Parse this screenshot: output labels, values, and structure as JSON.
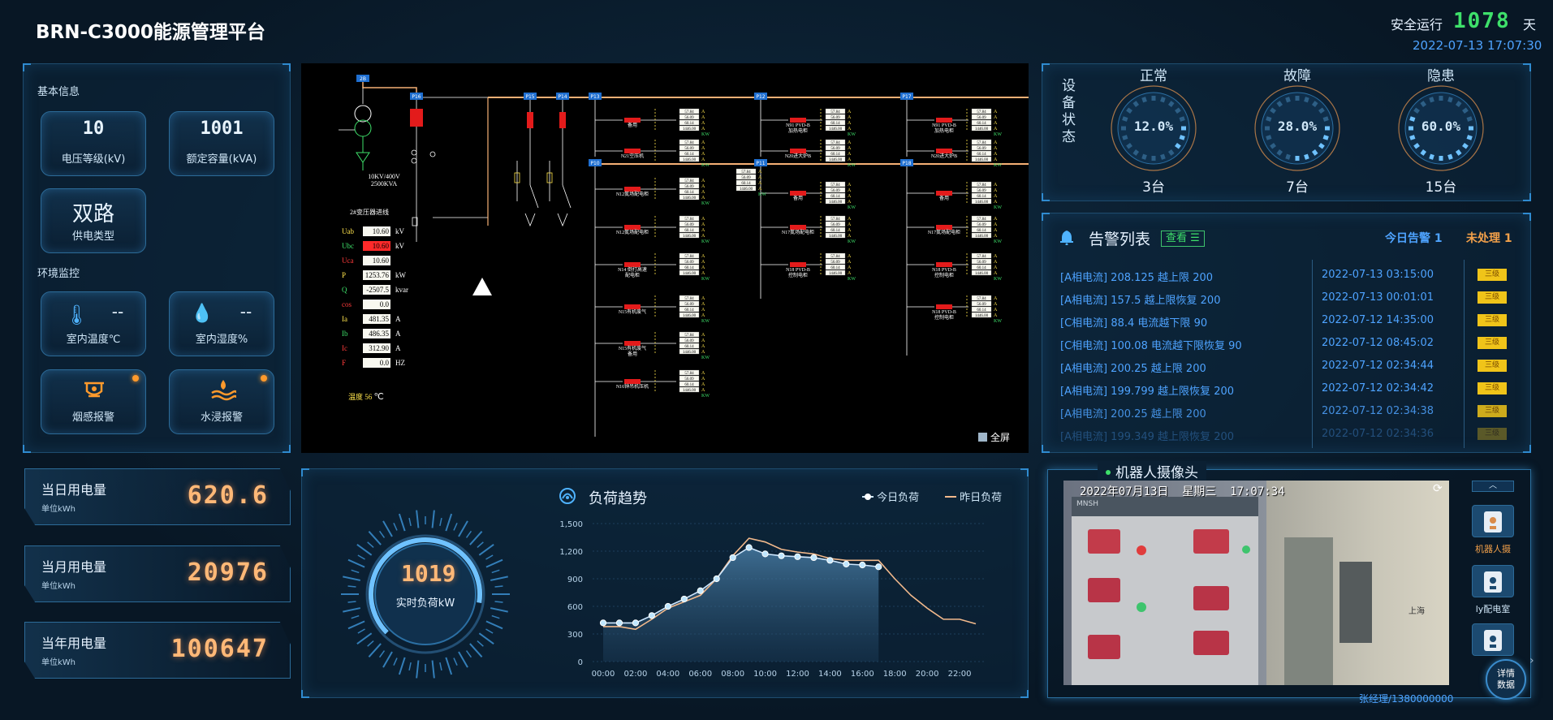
{
  "header": {
    "title": "BRN-C3000能源管理平台",
    "safe_run_label": "安全运行",
    "safe_run_days": "1078",
    "safe_run_unit": "天",
    "datetime": "2022-07-13 17:07:30"
  },
  "basic_info": {
    "title": "基本信息",
    "voltage": {
      "value": "10",
      "label": "电压等级(kV)"
    },
    "capacity": {
      "value": "1001",
      "label": "额定容量(kVA)"
    },
    "supply": {
      "value": "双路",
      "label": "供电类型"
    }
  },
  "env_monitor": {
    "title": "环境监控",
    "temp": {
      "value": "--",
      "label": "室内温度℃"
    },
    "humidity": {
      "value": "--",
      "label": "室内湿度%"
    },
    "smoke": {
      "label": "烟感报警"
    },
    "water": {
      "label": "水浸报警"
    }
  },
  "energy": {
    "day": {
      "title": "当日用电量",
      "unit": "单位kWh",
      "value": "620.6"
    },
    "month": {
      "title": "当月用电量",
      "unit": "单位kWh",
      "value": "20976"
    },
    "year": {
      "title": "当年用电量",
      "unit": "单位kWh",
      "value": "100647"
    }
  },
  "diagram": {
    "fullscreen": "全屏",
    "transformer_spec": "10KV/400V\n2500KVA",
    "transformer_label": "2#变压器进线",
    "temp_label": "温度",
    "temp_value": "56",
    "temp_unit": "℃",
    "meter_rows": [
      {
        "name": "Uab",
        "value": "10.60",
        "unit": "kV",
        "alarm": false
      },
      {
        "name": "Ubc",
        "value": "10.60",
        "unit": "kV",
        "alarm": true
      },
      {
        "name": "Uca",
        "value": "10.60",
        "unit": "",
        "alarm": false
      },
      {
        "name": "P",
        "value": "1253.76",
        "unit": "kW",
        "alarm": false
      },
      {
        "name": "Q",
        "value": "-2507.5",
        "unit": "kvar",
        "alarm": false
      },
      {
        "name": "cos",
        "value": "0.0",
        "unit": "",
        "alarm": false
      },
      {
        "name": "Ia",
        "value": "481.35",
        "unit": "A",
        "alarm": false
      },
      {
        "name": "Ib",
        "value": "486.35",
        "unit": "A",
        "alarm": false
      },
      {
        "name": "Ic",
        "value": "312.90",
        "unit": "A",
        "alarm": false
      },
      {
        "name": "F",
        "value": "0.0",
        "unit": "HZ",
        "alarm": false
      }
    ],
    "bus_tags": [
      "2B",
      "P16",
      "P15",
      "P14",
      "P13",
      "P12",
      "P17",
      "P11",
      "P18",
      "P10"
    ],
    "feeders_row1": [
      "备用",
      "N21空压机",
      "N91 PVD-B\n加热电柜",
      "N20进大炉B",
      "N91 PVD-B\n加热电柜",
      "N20进大炉B"
    ],
    "feeders_row2": [
      "N12氮场配电柜",
      "N12氮场配电柜",
      "N14 倒打高速\n配电柜",
      "N15有机废气",
      "N15有机废气\n备用",
      "N16钟吊机压机"
    ],
    "feeders_row2b": [
      "备用",
      "N17氮场配电柜",
      "N18 PVD-B\n控制电柜"
    ],
    "feeders_row2c": [
      "备用",
      "N17氮场配电柜",
      "N18 PVD-B\n控制电柜",
      "N18 PVD-B\n控制电柜"
    ],
    "small_vals": [
      "57.84",
      "56.09",
      "60.14",
      "1446.00"
    ],
    "kw": "KW",
    "amp": "A"
  },
  "load_gauge": {
    "value": "1019",
    "label": "实时负荷kW"
  },
  "load_trend": {
    "title": "负荷趋势",
    "legend_today": "今日负荷",
    "legend_yesterday": "昨日负荷"
  },
  "chart_data": {
    "type": "line",
    "title": "负荷趋势",
    "x": [
      "00:00",
      "01:00",
      "02:00",
      "03:00",
      "04:00",
      "05:00",
      "06:00",
      "07:00",
      "08:00",
      "09:00",
      "10:00",
      "11:00",
      "12:00",
      "13:00",
      "14:00",
      "15:00",
      "16:00",
      "17:00",
      "18:00",
      "19:00",
      "20:00",
      "21:00",
      "22:00",
      "23:00"
    ],
    "xticks": [
      "00:00",
      "02:00",
      "04:00",
      "06:00",
      "08:00",
      "10:00",
      "12:00",
      "14:00",
      "16:00",
      "18:00",
      "20:00",
      "22:00"
    ],
    "ylim": [
      0,
      1500
    ],
    "yticks": [
      0,
      300,
      600,
      900,
      1200,
      1500
    ],
    "ytick_labels": [
      "0",
      "300",
      "600",
      "900",
      "1,200",
      "1,500"
    ],
    "series": [
      {
        "name": "今日负荷",
        "color": "#cfe8ff",
        "values": [
          420,
          420,
          420,
          500,
          600,
          680,
          770,
          900,
          1130,
          1240,
          1170,
          1150,
          1140,
          1130,
          1100,
          1060,
          1050,
          1030
        ]
      },
      {
        "name": "昨日负荷",
        "color": "#f2b98c",
        "values": [
          380,
          380,
          350,
          460,
          580,
          650,
          720,
          900,
          1150,
          1340,
          1300,
          1220,
          1190,
          1170,
          1120,
          1100,
          1100,
          1100,
          900,
          720,
          580,
          460,
          460,
          410
        ]
      }
    ]
  },
  "device_status": {
    "title": "设备状态",
    "normal": {
      "label": "正常",
      "percent": "12.0%",
      "count": "3台",
      "fraction": 0.12
    },
    "fault": {
      "label": "故障",
      "percent": "28.0%",
      "count": "7台",
      "fraction": 0.28
    },
    "hidden": {
      "label": "隐患",
      "percent": "60.0%",
      "count": "15台",
      "fraction": 0.6
    }
  },
  "alarms": {
    "title": "告警列表",
    "view_button": "查看",
    "today_label": "今日告警",
    "today_count": "1",
    "unhandled_label": "未处理",
    "unhandled_count": "1",
    "badge": "三级",
    "rows": [
      {
        "msg": "[A相电流] 208.125 越上限 200",
        "date": "2022-07-13 03:15:00"
      },
      {
        "msg": "[A相电流] 157.5 越上限恢复 200",
        "date": "2022-07-13 00:01:01"
      },
      {
        "msg": "[C相电流] 88.4 电流越下限 90",
        "date": "2022-07-12 14:35:00"
      },
      {
        "msg": "[C相电流] 100.08 电流越下限恢复 90",
        "date": "2022-07-12 08:45:02"
      },
      {
        "msg": "[A相电流] 200.25 越上限 200",
        "date": "2022-07-12 02:34:44"
      },
      {
        "msg": "[A相电流] 199.799 越上限恢复 200",
        "date": "2022-07-12 02:34:42"
      },
      {
        "msg": "[A相电流] 200.25 越上限 200",
        "date": "2022-07-12 02:34:38"
      },
      {
        "msg": "[A相电流] 199.349 越上限恢复 200",
        "date": "2022-07-12 02:34:36"
      }
    ]
  },
  "robot_camera": {
    "title": "机器人摄像头",
    "overlay": "2022年07月13日  星期三  17:07:34",
    "caption": "张经理/1380000000",
    "side_items": [
      "机器人摄",
      "ly配电室",
      ""
    ],
    "detail_button": "详情\n数据",
    "cabinet_text": "MNSH",
    "wall_text": "上海"
  }
}
